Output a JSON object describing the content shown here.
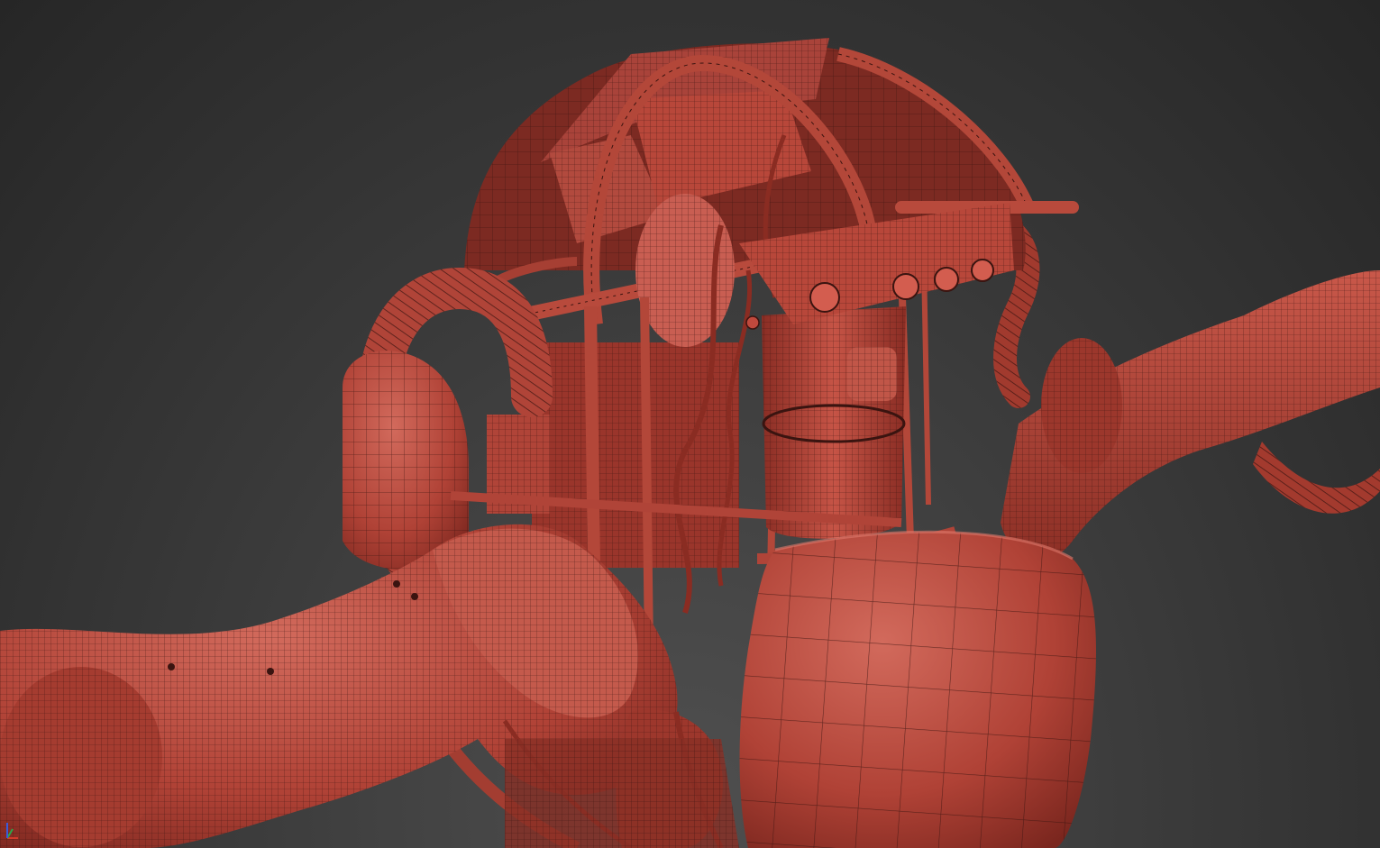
{
  "viewport": {
    "mode": "shaded-wireframe",
    "background": "#2f2f2f",
    "model_color": "#b8473a",
    "wire_color": "#3a1410"
  },
  "gizmo": {
    "axes": [
      "x-axis",
      "y-axis",
      "z-axis"
    ],
    "colors": {
      "x": "#d23a2a",
      "y": "#2aa84a",
      "z": "#3a5ad8"
    }
  }
}
